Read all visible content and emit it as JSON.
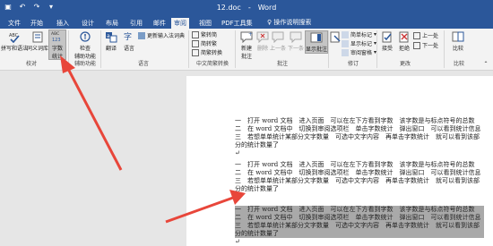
{
  "title_bar": {
    "filename": "12.doc",
    "separator": "-",
    "app_name": "Word"
  },
  "tabs": [
    {
      "label": "文件"
    },
    {
      "label": "开始"
    },
    {
      "label": "插入"
    },
    {
      "label": "设计"
    },
    {
      "label": "布局"
    },
    {
      "label": "引用"
    },
    {
      "label": "邮件"
    },
    {
      "label": "审阅"
    },
    {
      "label": "视图"
    },
    {
      "label": "PDF工具集"
    }
  ],
  "tell_me": "操作说明搜索",
  "ribbon": {
    "spelling": "拼写和语法",
    "thesaurus": "同义词库",
    "word_count_line1": "字数",
    "word_count_line2": "统计",
    "accessibility_line1": "检查",
    "accessibility_line2": "辅助功能",
    "translate": "翻译",
    "language": "语言",
    "update_ime": "更新输入法词典",
    "trad_to_simp": "繁转简",
    "simp_to_trad": "简转繁",
    "convert": "简繁转换",
    "new_comment_line1": "新建",
    "new_comment_line2": "批注",
    "delete": "删除",
    "previous": "上一条",
    "next": "下一条",
    "show_comments": "显示批注",
    "markup_select": "简单标记",
    "show_markup": "显示标记",
    "reviewing_pane": "审阅窗格",
    "accept": "接受",
    "reject": "拒绝",
    "prev_change": "上一处",
    "next_change": "下一处",
    "compare": "比较",
    "groups": {
      "proofing": "校对",
      "accessibility": "辅助功能",
      "language": "语言",
      "chinese_conversion": "中文简繁转换",
      "comments": "批注",
      "tracking": "修订",
      "changes": "更改",
      "compare": "比较"
    }
  },
  "document": {
    "paragraphs": [
      {
        "lines": [
          "一　打开 word 文档　进入页面　可以在左下方看到字数　该字数是与标点符号的总数",
          "二　在 word 文档中　切换到审阅选项栏　单击字数统计　弹出窗口　可以看到统计信息",
          "三　若想单单统计某部分文字数量　可选中文字内容　再单击字数统计　就可以看到该部",
          "分的统计数量了"
        ],
        "highlighted": false
      },
      {
        "lines": [
          "一　打开 word 文档　进入页面　可以在左下方看到字数　该字数是与标点符号的总数",
          "二　在 word 文档中　切换到审阅选项栏　单击字数统计　弹出窗口　可以看到统计信息",
          "三　若想单单统计某部分文字数量　可选中文字内容　再单击字数统计　就可以看到该部",
          "分的统计数量了"
        ],
        "highlighted": false
      },
      {
        "lines": [
          "一　打开 word 文档　进入页面　可以在左下方看到字数　该字数是与标点符号的总数",
          "二　在 word 文档中　切换到审阅选项栏　单击字数统计　弹出窗口　可以看到统计信息",
          "三　若想单单统计某部分文字数量　可选中文字内容　再单击字数统计　就可以看到该部",
          "分的统计数量了"
        ],
        "highlighted": true
      }
    ],
    "paragraph_mark": "↵"
  },
  "colors": {
    "title_blue": "#2b579a",
    "ribbon_bg": "#f3f3f3",
    "selection_gray": "#a9a9a9",
    "arrow_red": "#e8463a"
  }
}
